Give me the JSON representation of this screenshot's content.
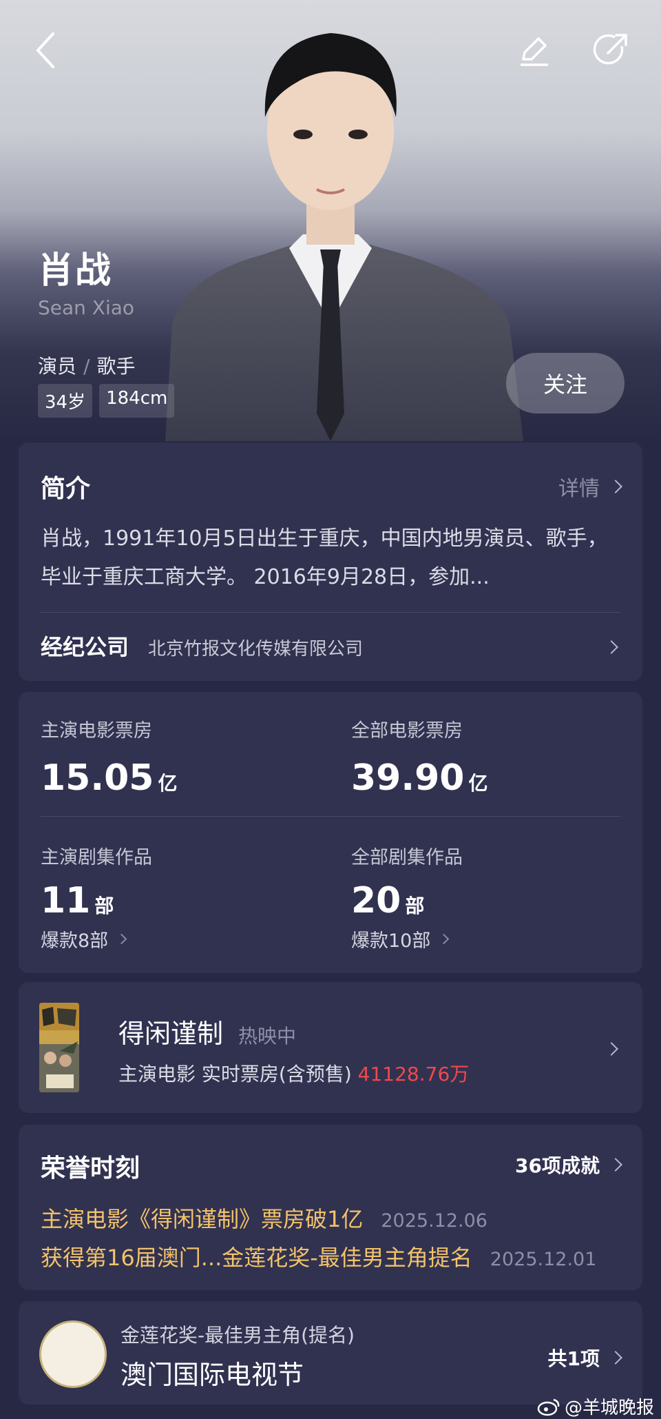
{
  "profile": {
    "name": "肖战",
    "english_name": "Sean Xiao",
    "roles": [
      "演员",
      "歌手"
    ],
    "role_separator": "/",
    "age": "34岁",
    "height": "184cm",
    "follow_label": "关注"
  },
  "intro": {
    "title": "简介",
    "detail_label": "详情",
    "text": "肖战，1991年10月5日出生于重庆，中国内地男演员、歌手，毕业于重庆工商大学。 2016年9月28日，参加...",
    "agency_label": "经纪公司",
    "agency_name": "北京竹报文化传媒有限公司"
  },
  "stats": {
    "lead_box_office": {
      "label": "主演电影票房",
      "value": "15.05",
      "unit": "亿"
    },
    "total_box_office": {
      "label": "全部电影票房",
      "value": "39.90",
      "unit": "亿"
    },
    "lead_series": {
      "label": "主演剧集作品",
      "value": "11",
      "unit": "部",
      "hits": "爆款8部"
    },
    "total_series": {
      "label": "全部剧集作品",
      "value": "20",
      "unit": "部",
      "hits": "爆款10部"
    }
  },
  "movie": {
    "title": "得闲谨制",
    "status": "热映中",
    "info_prefix": "主演电影  实时票房(含预售)",
    "box_office": "41128.76万"
  },
  "honors": {
    "title": "荣誉时刻",
    "count_label": "36项成就",
    "items": [
      {
        "text": "主演电影《得闲谨制》票房破1亿",
        "date": "2025.12.06"
      },
      {
        "text": "获得第16届澳门...金莲花奖-最佳男主角提名",
        "date": "2025.12.01"
      }
    ]
  },
  "award": {
    "category": "金莲花奖-最佳男主角(提名)",
    "festival": "澳门国际电视节",
    "total": "共1项"
  },
  "watermark": "@羊城晚报",
  "colors": {
    "background": "#272843",
    "card": "#313250",
    "honor_text": "#f3c26a",
    "box_office_red": "#f2484d"
  }
}
